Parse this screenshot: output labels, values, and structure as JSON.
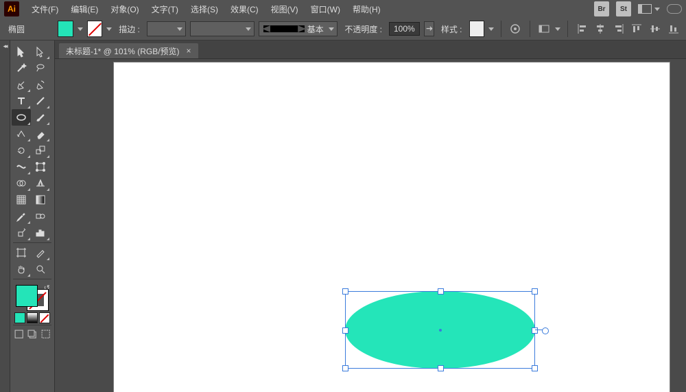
{
  "app": {
    "logo_text": "Ai"
  },
  "menu": {
    "items": [
      "文件(F)",
      "编辑(E)",
      "对象(O)",
      "文字(T)",
      "选择(S)",
      "效果(C)",
      "视图(V)",
      "窗口(W)",
      "帮助(H)"
    ],
    "br_label": "Br",
    "st_label": "St"
  },
  "options": {
    "tool_name": "椭圆",
    "fill_color": "#24e4b8",
    "stroke_label": "描边 :",
    "brush_label": "基本",
    "opacity_label": "不透明度 :",
    "opacity_value": "100%",
    "style_label": "样式 :"
  },
  "document": {
    "tab_title": "未标题-1* @ 101% (RGB/预览)"
  },
  "shape": {
    "fill": "#24e5b9"
  }
}
